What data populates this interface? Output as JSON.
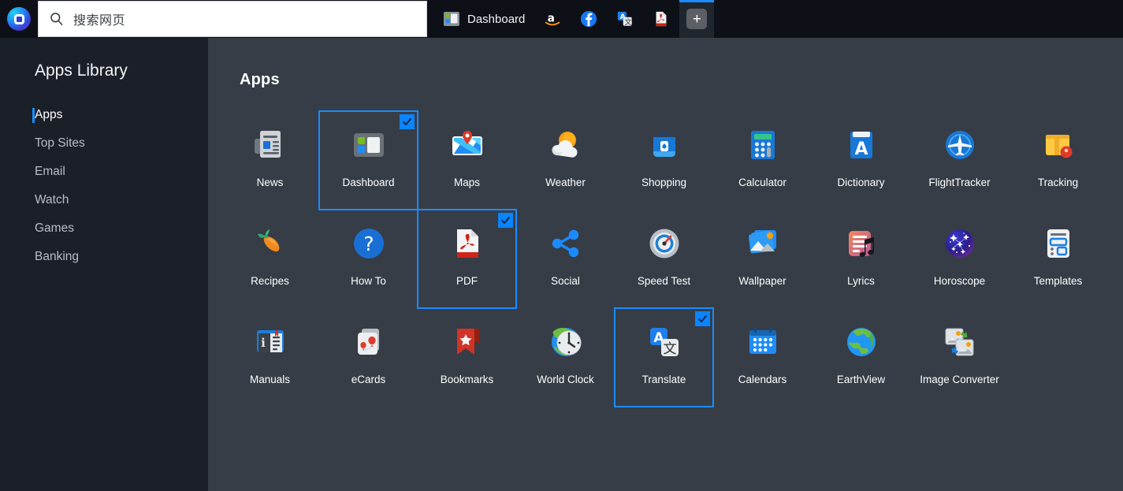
{
  "browser": {
    "logo_icon": "browser-logo-icon",
    "search": {
      "icon": "search-icon",
      "value": "搜索网页"
    },
    "tabs": [
      {
        "label": "Dashboard",
        "icon": "dashboard-icon"
      },
      {
        "label": "",
        "icon": "amazon-icon"
      },
      {
        "label": "",
        "icon": "facebook-icon"
      },
      {
        "label": "",
        "icon": "translate-icon"
      },
      {
        "label": "",
        "icon": "pdf-icon"
      }
    ],
    "new_tab_label": "+"
  },
  "sidebar": {
    "title": "Apps Library",
    "items": [
      {
        "label": "Apps",
        "active": true
      },
      {
        "label": "Top Sites",
        "active": false
      },
      {
        "label": "Email",
        "active": false
      },
      {
        "label": "Watch",
        "active": false
      },
      {
        "label": "Games",
        "active": false
      },
      {
        "label": "Banking",
        "active": false
      }
    ]
  },
  "main": {
    "title": "Apps",
    "apps": [
      {
        "label": "News",
        "icon": "news-icon",
        "selected": false
      },
      {
        "label": "Dashboard",
        "icon": "dashboard-icon",
        "selected": true
      },
      {
        "label": "Maps",
        "icon": "maps-icon",
        "selected": false
      },
      {
        "label": "Weather",
        "icon": "weather-icon",
        "selected": false
      },
      {
        "label": "Shopping",
        "icon": "shopping-icon",
        "selected": false
      },
      {
        "label": "Calculator",
        "icon": "calculator-icon",
        "selected": false
      },
      {
        "label": "Dictionary",
        "icon": "dictionary-icon",
        "selected": false
      },
      {
        "label": "FlightTracker",
        "icon": "flight-tracker-icon",
        "selected": false
      },
      {
        "label": "Tracking",
        "icon": "tracking-icon",
        "selected": false
      },
      {
        "label": "Recipes",
        "icon": "recipes-icon",
        "selected": false
      },
      {
        "label": "How To",
        "icon": "how-to-icon",
        "selected": false
      },
      {
        "label": "PDF",
        "icon": "pdf-icon",
        "selected": true
      },
      {
        "label": "Social",
        "icon": "social-icon",
        "selected": false
      },
      {
        "label": "Speed Test",
        "icon": "speed-test-icon",
        "selected": false
      },
      {
        "label": "Wallpaper",
        "icon": "wallpaper-icon",
        "selected": false
      },
      {
        "label": "Lyrics",
        "icon": "lyrics-icon",
        "selected": false
      },
      {
        "label": "Horoscope",
        "icon": "horoscope-icon",
        "selected": false
      },
      {
        "label": "Templates",
        "icon": "templates-icon",
        "selected": false
      },
      {
        "label": "Manuals",
        "icon": "manuals-icon",
        "selected": false
      },
      {
        "label": "eCards",
        "icon": "ecards-icon",
        "selected": false
      },
      {
        "label": "Bookmarks",
        "icon": "bookmarks-icon",
        "selected": false
      },
      {
        "label": "World Clock",
        "icon": "world-clock-icon",
        "selected": false
      },
      {
        "label": "Translate",
        "icon": "translate-icon",
        "selected": true
      },
      {
        "label": "Calendars",
        "icon": "calendars-icon",
        "selected": false
      },
      {
        "label": "EarthView",
        "icon": "earth-view-icon",
        "selected": false
      },
      {
        "label": "Image Converter",
        "icon": "image-converter-icon",
        "selected": false
      }
    ]
  },
  "colors": {
    "accent": "#1a8cff",
    "checkbox": "#0a84ff",
    "topbar_bg": "#0d1117",
    "sidebar_bg": "#1b2028",
    "content_bg": "#363d47"
  }
}
